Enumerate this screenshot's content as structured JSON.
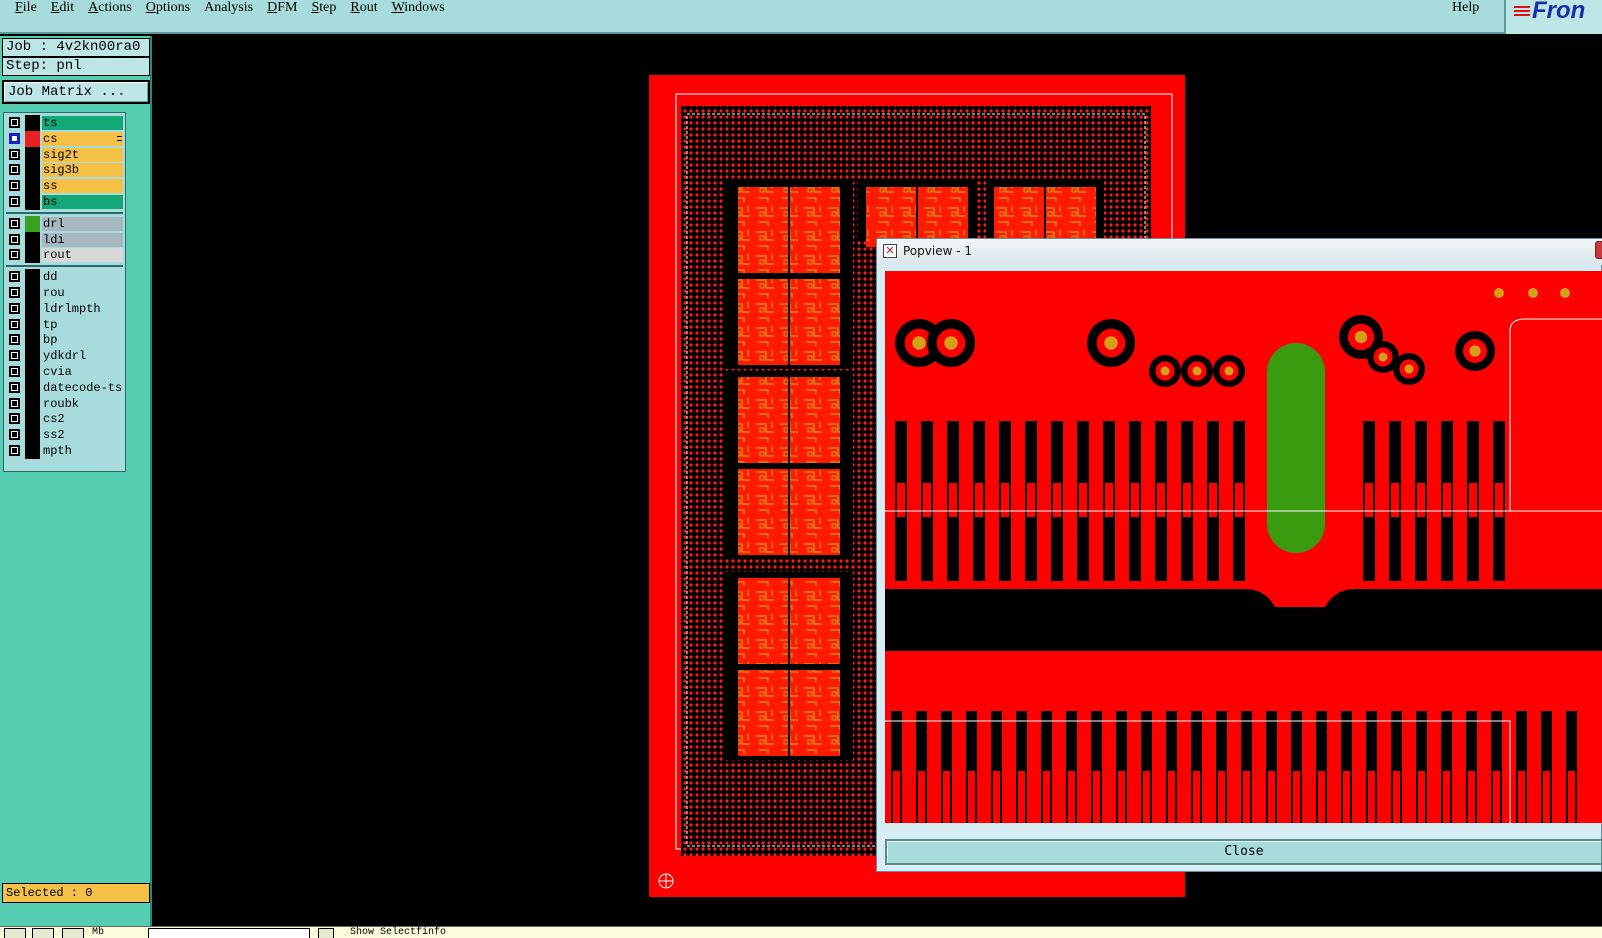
{
  "menubar": {
    "items": [
      {
        "mnemonic": "F",
        "rest": "ile"
      },
      {
        "mnemonic": "E",
        "rest": "dit"
      },
      {
        "mnemonic": "A",
        "rest": "ctions"
      },
      {
        "mnemonic": "O",
        "rest": "ptions"
      },
      {
        "mnemonic": "",
        "rest": "Analysis"
      },
      {
        "mnemonic": "D",
        "rest": "FM"
      },
      {
        "mnemonic": "S",
        "rest": "tep"
      },
      {
        "mnemonic": "R",
        "rest": "out"
      },
      {
        "mnemonic": "W",
        "rest": "indows"
      }
    ],
    "help_label": "Help",
    "logo_text": "Fron"
  },
  "left": {
    "job_label": "Job : 4v2kn00ra0",
    "step_label": "Step: pnl",
    "job_matrix_label": "Job Matrix ...",
    "layers": [
      {
        "name": "ts",
        "color": "#12a878",
        "checked": true,
        "group": 1
      },
      {
        "name": "cs",
        "color": "#f4c045",
        "checked": true,
        "swatch": "#e82020",
        "active": true,
        "group": 1
      },
      {
        "name": "sig2t",
        "color": "#f4c045",
        "checked": true,
        "group": 1
      },
      {
        "name": "sig3b",
        "color": "#f4c045",
        "checked": true,
        "group": 1
      },
      {
        "name": "ss",
        "color": "#f4c045",
        "checked": true,
        "group": 1
      },
      {
        "name": "bs",
        "color": "#12a878",
        "checked": true,
        "group": 1
      },
      {
        "name": "drl",
        "color": "#a8b8c0",
        "checked": true,
        "swatch": "#3aa020",
        "group": 2
      },
      {
        "name": "ldi",
        "color": "#a8b8c0",
        "checked": true,
        "group": 2
      },
      {
        "name": "rout",
        "color": "#d8d8d8",
        "checked": true,
        "group": 2
      },
      {
        "name": "dd",
        "color": "#a8dcdc",
        "checked": true,
        "group": 3
      },
      {
        "name": "rou",
        "color": "#a8dcdc",
        "checked": true,
        "group": 3
      },
      {
        "name": "ldrlmpth",
        "color": "#a8dcdc",
        "checked": true,
        "group": 3
      },
      {
        "name": "tp",
        "color": "#a8dcdc",
        "checked": true,
        "group": 3
      },
      {
        "name": "bp",
        "color": "#a8dcdc",
        "checked": true,
        "group": 3
      },
      {
        "name": "ydkdrl",
        "color": "#a8dcdc",
        "checked": true,
        "group": 3
      },
      {
        "name": "cvia",
        "color": "#a8dcdc",
        "checked": true,
        "group": 3
      },
      {
        "name": "datecode-ts",
        "color": "#a8dcdc",
        "checked": true,
        "group": 3
      },
      {
        "name": "roubk",
        "color": "#a8dcdc",
        "checked": true,
        "group": 3
      },
      {
        "name": "cs2",
        "color": "#a8dcdc",
        "checked": true,
        "group": 3
      },
      {
        "name": "ss2",
        "color": "#a8dcdc",
        "checked": true,
        "group": 3
      },
      {
        "name": "mpth",
        "color": "#a8dcdc",
        "checked": true,
        "group": 3
      }
    ],
    "selected_label": "Selected : 0"
  },
  "statusbar": {
    "text_a": "Mb",
    "text_b": "Show Selectfinfo"
  },
  "popview": {
    "title": "Popview - 1",
    "close_label": "Close"
  },
  "colors": {
    "copper": "#ff0000",
    "gold": "#d4a017",
    "drill": "#3a9a10",
    "panel": "#55cdb0"
  }
}
